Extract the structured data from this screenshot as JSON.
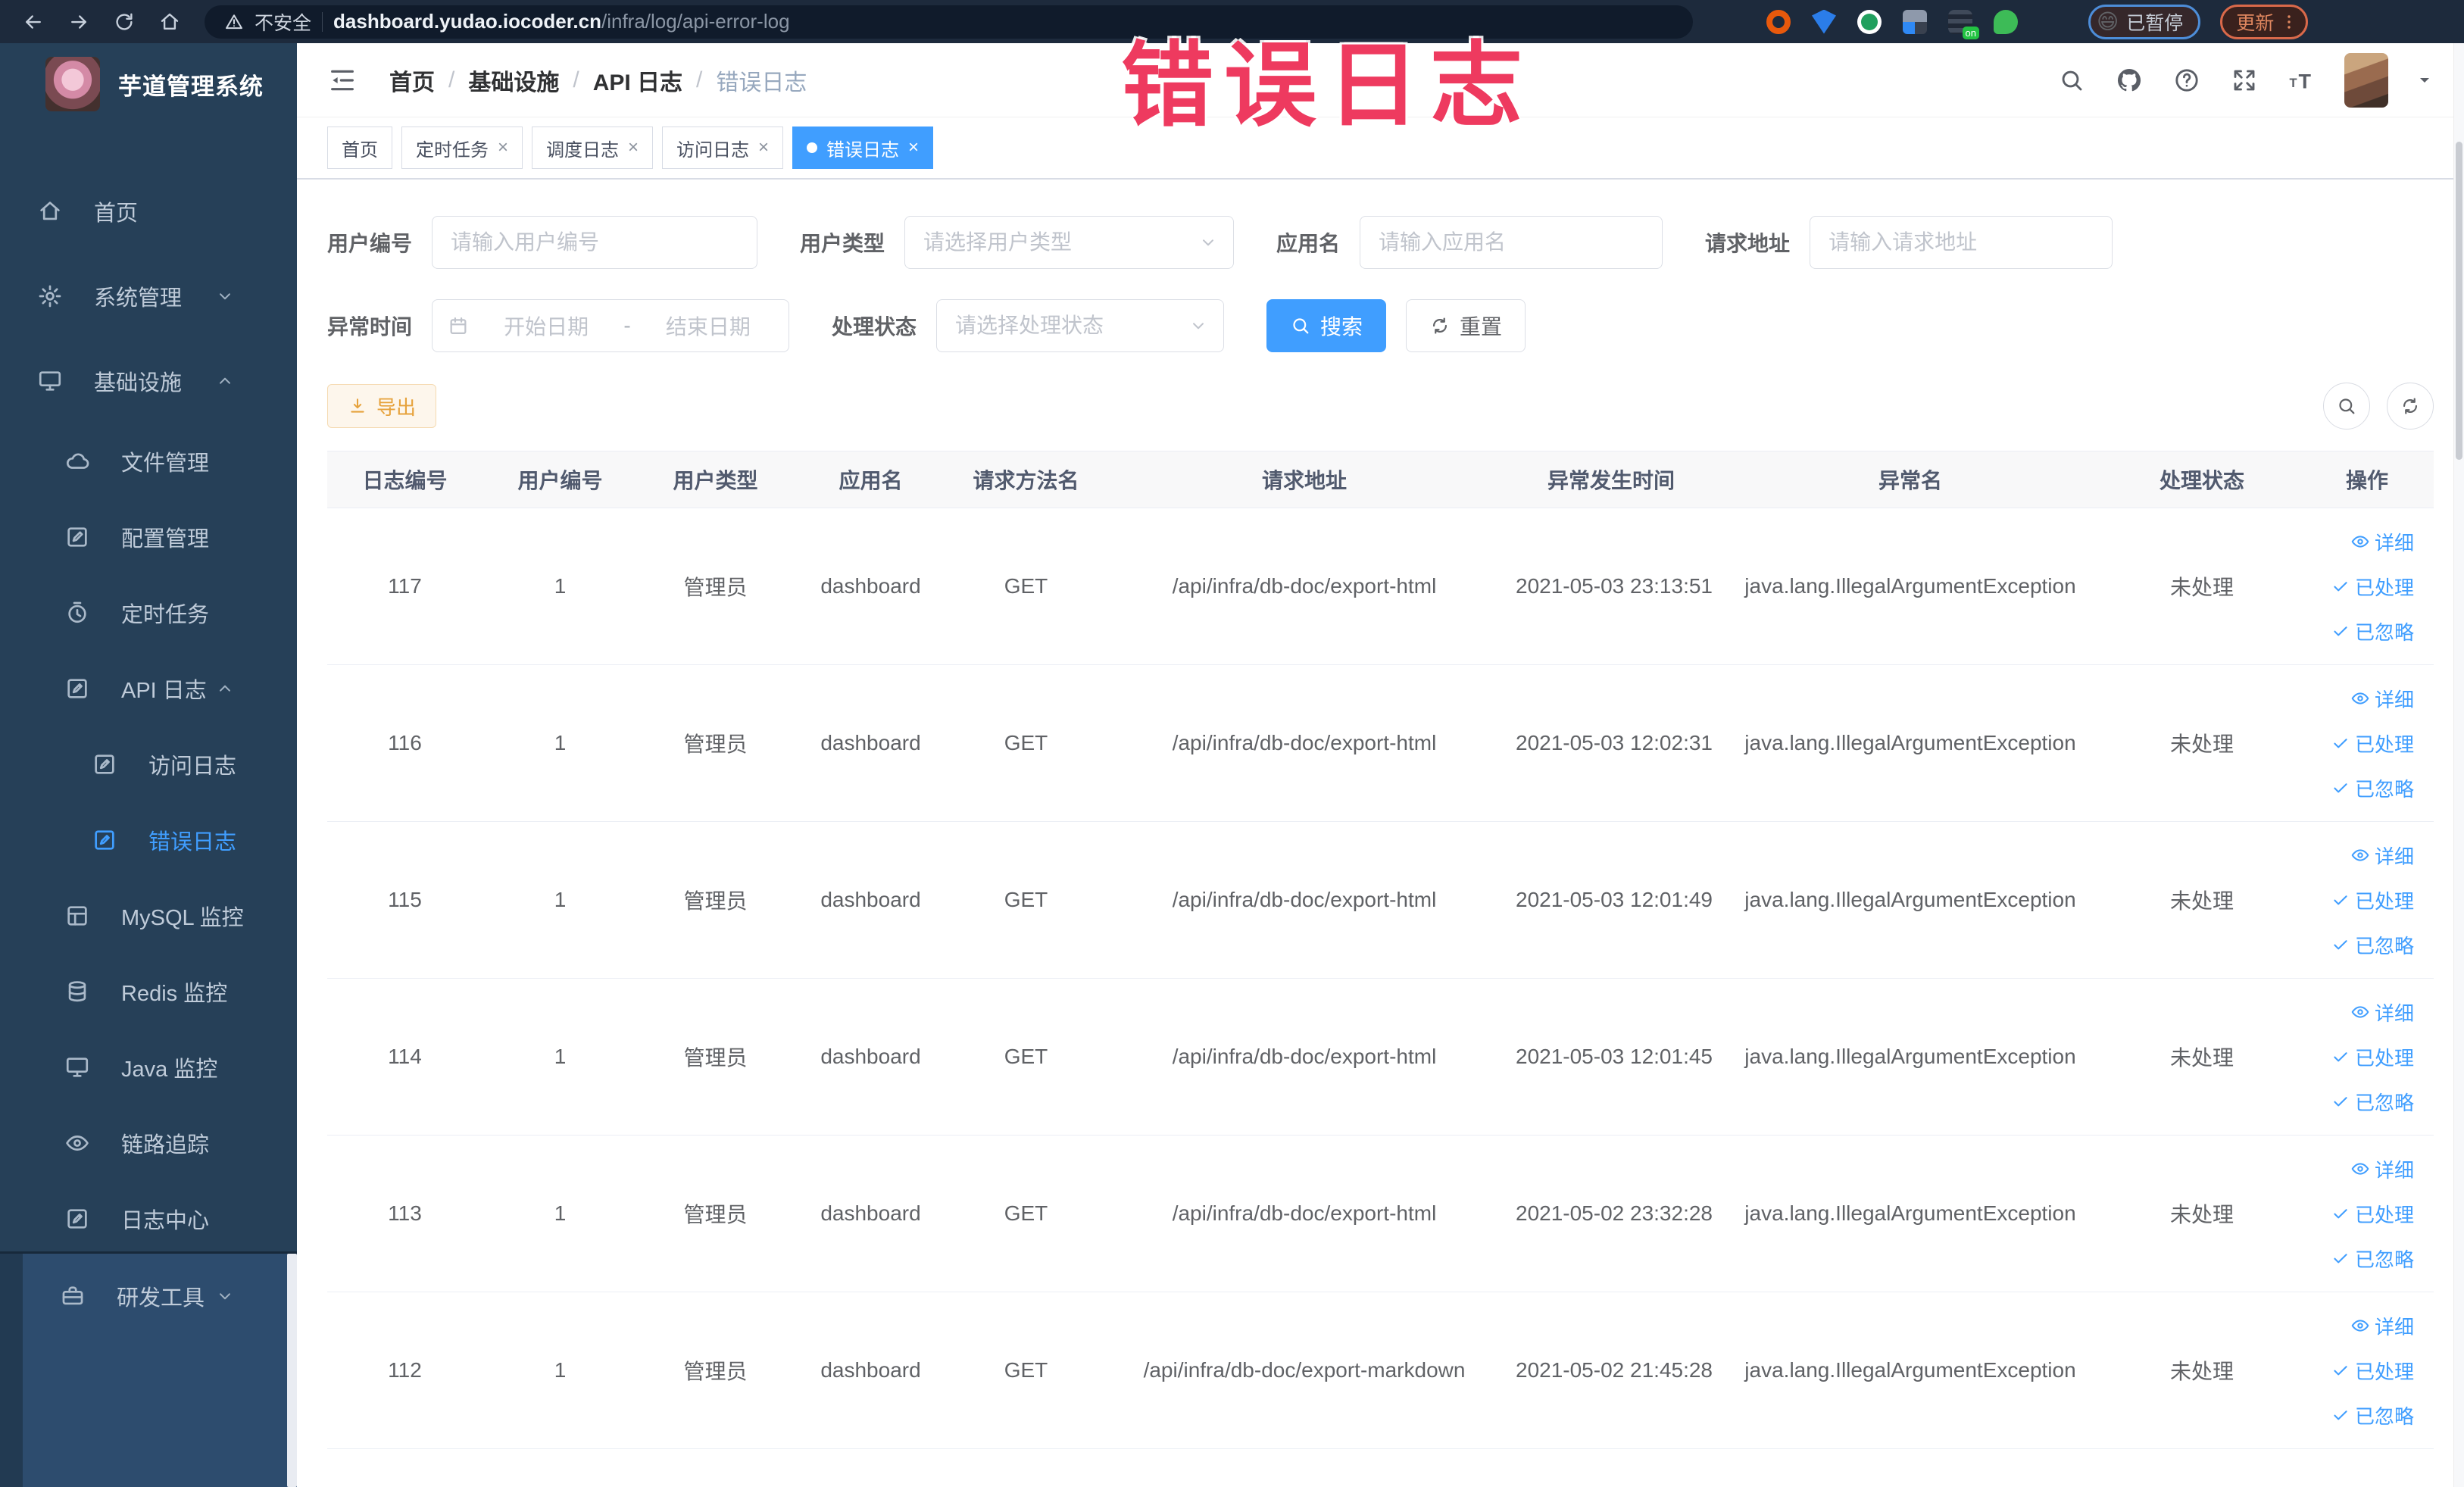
{
  "colors": {
    "accent": "#409eff",
    "warning": "#e6a23c",
    "annotation": "#ee3a5f",
    "sidebar_bg": "#264058"
  },
  "annotation": {
    "text": "错误日志"
  },
  "browser": {
    "security_label": "不安全",
    "url_domain": "dashboard.yudao.iocoder.cn",
    "url_path": "/infra/log/api-error-log",
    "profile_paused_label": "已暂停",
    "profile_emoji": "😄",
    "update_label": "更新"
  },
  "sidebar": {
    "title": "芋道管理系统",
    "items": [
      {
        "label": "首页",
        "icon": "home",
        "level": 1
      },
      {
        "label": "系统管理",
        "icon": "gear",
        "level": 1,
        "arrow": "down"
      },
      {
        "label": "基础设施",
        "icon": "monitor",
        "level": 1,
        "arrow": "up"
      },
      {
        "label": "文件管理",
        "icon": "cloud",
        "level": 2
      },
      {
        "label": "配置管理",
        "icon": "edit",
        "level": 2
      },
      {
        "label": "定时任务",
        "icon": "timer",
        "level": 2
      },
      {
        "label": "API 日志",
        "icon": "logdoc",
        "level": 2,
        "arrow": "up"
      },
      {
        "label": "访问日志",
        "icon": "logdoc",
        "level": 3
      },
      {
        "label": "错误日志",
        "icon": "logdoc",
        "level": 3,
        "active": true
      },
      {
        "label": "MySQL 监控",
        "icon": "grid",
        "level": 2
      },
      {
        "label": "Redis 监控",
        "icon": "db",
        "level": 2
      },
      {
        "label": "Java 监控",
        "icon": "monitor",
        "level": 2
      },
      {
        "label": "链路追踪",
        "icon": "eye",
        "level": 2
      },
      {
        "label": "日志中心",
        "icon": "logdoc",
        "level": 2
      }
    ],
    "bottom_item": {
      "label": "研发工具",
      "icon": "briefcase",
      "level": 1,
      "arrow": "down"
    }
  },
  "header": {
    "breadcrumb": [
      "首页",
      "基础设施",
      "API 日志",
      "错误日志"
    ],
    "separator": "/",
    "icon_names": [
      "search-icon",
      "github-icon",
      "help-icon",
      "fullscreen-icon",
      "font-size-icon"
    ]
  },
  "tabs": [
    {
      "label": "首页",
      "closable": false,
      "active": false
    },
    {
      "label": "定时任务",
      "closable": true,
      "active": false
    },
    {
      "label": "调度日志",
      "closable": true,
      "active": false
    },
    {
      "label": "访问日志",
      "closable": true,
      "active": false
    },
    {
      "label": "错误日志",
      "closable": true,
      "active": true
    }
  ],
  "filters": {
    "user_id": {
      "label": "用户编号",
      "placeholder": "请输入用户编号"
    },
    "user_type": {
      "label": "用户类型",
      "placeholder": "请选择用户类型"
    },
    "app_name": {
      "label": "应用名",
      "placeholder": "请输入应用名"
    },
    "request_url": {
      "label": "请求地址",
      "placeholder": "请输入请求地址"
    },
    "exception_time": {
      "label": "异常时间",
      "start_placeholder": "开始日期",
      "separator": "-",
      "end_placeholder": "结束日期"
    },
    "process_status": {
      "label": "处理状态",
      "placeholder": "请选择处理状态"
    },
    "search_label": "搜索",
    "reset_label": "重置"
  },
  "toolbar": {
    "export_label": "导出"
  },
  "table": {
    "columns": [
      "日志编号",
      "用户编号",
      "用户类型",
      "应用名",
      "请求方法名",
      "请求地址",
      "异常发生时间",
      "异常名",
      "处理状态",
      "操作"
    ],
    "action_labels": [
      "详细",
      "已处理",
      "已忽略"
    ],
    "rows": [
      {
        "id": "117",
        "user_id": "1",
        "user_type": "管理员",
        "app": "dashboard",
        "method": "GET",
        "url": "/api/infra/db-doc/export-html",
        "time": "2021-05-03 23:13:51",
        "exception": "java.lang.IllegalArgumentException",
        "status": "未处理"
      },
      {
        "id": "116",
        "user_id": "1",
        "user_type": "管理员",
        "app": "dashboard",
        "method": "GET",
        "url": "/api/infra/db-doc/export-html",
        "time": "2021-05-03 12:02:31",
        "exception": "java.lang.IllegalArgumentException",
        "status": "未处理"
      },
      {
        "id": "115",
        "user_id": "1",
        "user_type": "管理员",
        "app": "dashboard",
        "method": "GET",
        "url": "/api/infra/db-doc/export-html",
        "time": "2021-05-03 12:01:49",
        "exception": "java.lang.IllegalArgumentException",
        "status": "未处理"
      },
      {
        "id": "114",
        "user_id": "1",
        "user_type": "管理员",
        "app": "dashboard",
        "method": "GET",
        "url": "/api/infra/db-doc/export-html",
        "time": "2021-05-03 12:01:45",
        "exception": "java.lang.IllegalArgumentException",
        "status": "未处理"
      },
      {
        "id": "113",
        "user_id": "1",
        "user_type": "管理员",
        "app": "dashboard",
        "method": "GET",
        "url": "/api/infra/db-doc/export-html",
        "time": "2021-05-02 23:32:28",
        "exception": "java.lang.IllegalArgumentException",
        "status": "未处理"
      },
      {
        "id": "112",
        "user_id": "1",
        "user_type": "管理员",
        "app": "dashboard",
        "method": "GET",
        "url": "/api/infra/db-doc/export-markdown",
        "time": "2021-05-02 21:45:28",
        "exception": "java.lang.IllegalArgumentException",
        "status": "未处理"
      }
    ]
  }
}
